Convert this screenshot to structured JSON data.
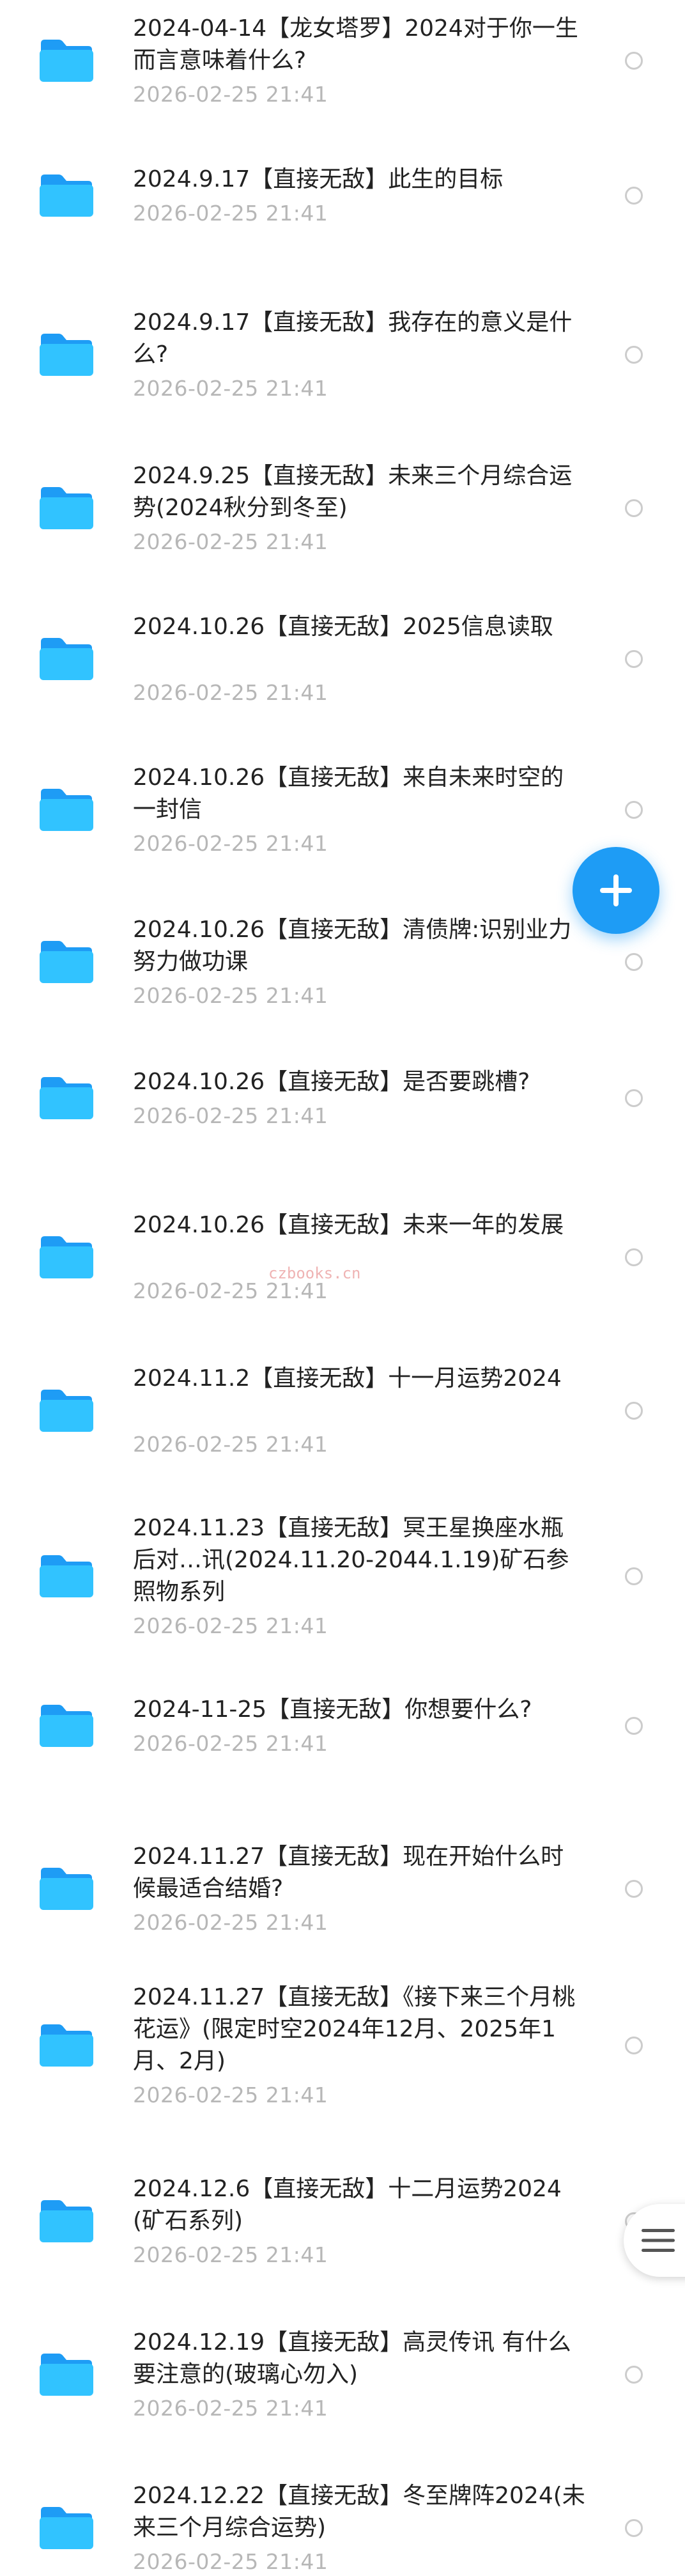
{
  "colors": {
    "accent": "#1e9cf5",
    "folder_back": "#1e9cf5",
    "folder_front": "#31c3ff",
    "title": "#222222",
    "date": "#b7b7b7"
  },
  "items": [
    {
      "title": "2024-04-14【龙女塔罗】2024对于你一生而言意味着什么?",
      "date": "2026-02-25  21:41"
    },
    {
      "title": "2024.9.17【直接无敌】此生的目标",
      "date": "2026-02-25  21:41"
    },
    {
      "title": "2024.9.17【直接无敌】我存在的意义是什么?",
      "date": "2026-02-25  21:41"
    },
    {
      "title": "2024.9.25【直接无敌】未来三个月综合运势(2024秋分到冬至)",
      "date": "2026-02-25  21:41"
    },
    {
      "title": "2024.10.26【直接无敌】2025信息读取",
      "date": "2026-02-25  21:41"
    },
    {
      "title": "2024.10.26【直接无敌】来自未来时空的一封信",
      "date": "2026-02-25  21:41"
    },
    {
      "title": "2024.10.26【直接无敌】清债牌:识别业力 努力做功课",
      "date": "2026-02-25  21:41"
    },
    {
      "title": "2024.10.26【直接无敌】是否要跳槽?",
      "date": "2026-02-25  21:41"
    },
    {
      "title": "2024.10.26【直接无敌】未来一年的发展",
      "date": "2026-02-25  21:41"
    },
    {
      "title": "2024.11.2【直接无敌】十一月运势2024",
      "date": "2026-02-25  21:41"
    },
    {
      "title": "2024.11.23【直接无敌】冥王星换座水瓶后对…讯(2024.11.20-2044.1.19)矿石参照物系列",
      "date": "2026-02-25  21:41"
    },
    {
      "title": "2024-11-25【直接无敌】你想要什么?",
      "date": "2026-02-25  21:41"
    },
    {
      "title": "2024.11.27【直接无敌】现在开始什么时候最适合结婚?",
      "date": "2026-02-25  21:41"
    },
    {
      "title": "2024.11.27【直接无敌】《接下来三个月桃花运》(限定时空2024年12月、2025年1月、2月)",
      "date": "2026-02-25  21:41"
    },
    {
      "title": "2024.12.6【直接无敌】十二月运势2024(矿石系列)",
      "date": "2026-02-25  21:41"
    },
    {
      "title": "2024.12.19【直接无敌】高灵传讯 有什么要注意的(玻璃心勿入)",
      "date": "2026-02-25  21:41"
    },
    {
      "title": "2024.12.22【直接无敌】冬至牌阵2024(未来三个月综合运势)",
      "date": "2026-02-25  21:41"
    }
  ],
  "watermark": "czbooks.cn",
  "icons": {
    "item": "folder-icon",
    "select": "radio-circle-icon",
    "fab": "plus-icon",
    "menu": "hamburger-menu-icon"
  }
}
